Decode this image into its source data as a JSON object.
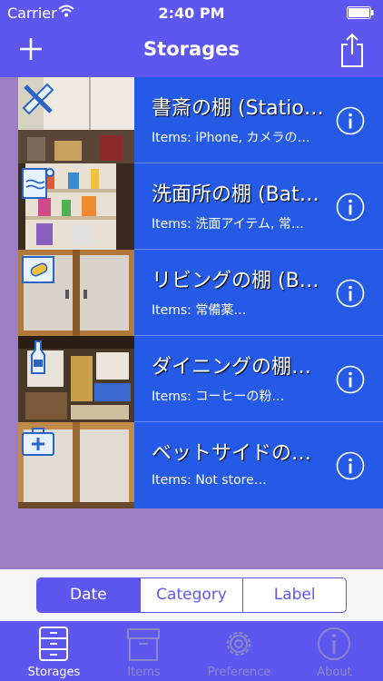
{
  "status": {
    "carrier": "Carrier",
    "time": "2:40 PM"
  },
  "nav": {
    "title": "Storages"
  },
  "storages": [
    {
      "name": "書斎の棚 (Statio…",
      "items": "Items: iPhone, カメラの…",
      "icon": "ruler-pencil-icon"
    },
    {
      "name": "洗面所の棚 (Bat…",
      "items": "Items: 洗面アイテム, 常…",
      "icon": "bath-towel-icon"
    },
    {
      "name": "リビングの棚 (B…",
      "items": "Items: 常備薬…",
      "icon": "bandage-icon"
    },
    {
      "name": "ダイニングの棚…",
      "items": "Items: コーヒーの粉…",
      "icon": "bottle-icon"
    },
    {
      "name": "ベットサイドの…",
      "items": "Items: Not store…",
      "icon": "first-aid-kit-icon"
    }
  ],
  "sort": {
    "options": [
      "Date",
      "Category",
      "Label"
    ],
    "selected": "Date"
  },
  "tabs": [
    {
      "label": "Storages",
      "icon": "drawers-icon",
      "selected": true
    },
    {
      "label": "Items",
      "icon": "box-icon",
      "selected": false
    },
    {
      "label": "Preference",
      "icon": "gear-icon",
      "selected": false
    },
    {
      "label": "About",
      "icon": "info-icon",
      "selected": false
    }
  ]
}
